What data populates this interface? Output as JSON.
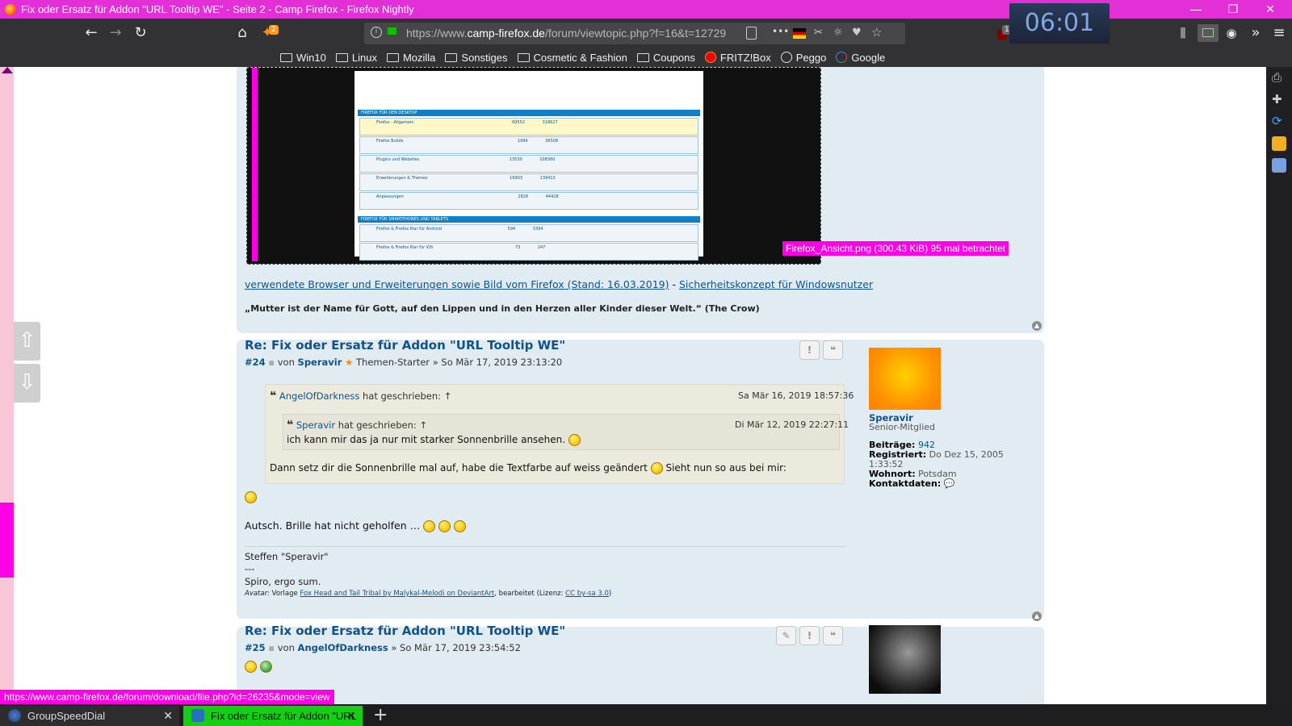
{
  "window": {
    "title": "Fix oder Ersatz für Addon \"URL Tooltip WE\" - Seite 2 - Camp Firefox - Firefox Nightly",
    "minimize": "—",
    "restore": "❐",
    "close": "✕",
    "clock": "06:01"
  },
  "toolbar": {
    "back": "←",
    "forward": "→",
    "reload": "↻",
    "home": "⌂",
    "addon_badge": "2",
    "url_prefix": "https://www.",
    "url_domain": "camp-firefox.de",
    "url_path": "/forum/viewtopic.php?f=16&t=12729",
    "more": "•••",
    "ublock_badge": "1",
    "overflow": "»",
    "menu": "≡"
  },
  "bookmarks": [
    {
      "label": "Win10",
      "icon": "folder-icon"
    },
    {
      "label": "Linux",
      "icon": "folder-icon"
    },
    {
      "label": "Mozilla",
      "icon": "folder-icon"
    },
    {
      "label": "Sonstiges",
      "icon": "folder-icon"
    },
    {
      "label": "Cosmetic & Fashion",
      "icon": "folder-icon"
    },
    {
      "label": "Coupons",
      "icon": "folder-icon"
    },
    {
      "label": "FRITZ!Box",
      "icon": "fritzbox-icon"
    },
    {
      "label": "Peggo",
      "icon": "globe-icon"
    },
    {
      "label": "Google",
      "icon": "google-icon"
    }
  ],
  "attachment": {
    "caption": "Firefox_Ansicht.png (300.43 KiB) 95 mal betrachtet",
    "forum_rows": [
      {
        "title": "Firefox - Allgemein",
        "themen": "69552",
        "beitraege": "318627"
      },
      {
        "title": "Firefox Builds",
        "themen": "1999",
        "beitraege": "36508"
      },
      {
        "title": "Plugins und Websites",
        "themen": "13530",
        "beitraege": "108360"
      },
      {
        "title": "Erweiterungen & Themes",
        "themen": "16903",
        "beitraege": "139413"
      },
      {
        "title": "Anpassungen",
        "themen": "2828",
        "beitraege": "44428"
      },
      {
        "title": "Firefox & Firefox Klar für Android",
        "themen": "594",
        "beitraege": "3394"
      },
      {
        "title": "Firefox & Firefox Klar für iOS",
        "themen": "73",
        "beitraege": "247"
      }
    ]
  },
  "prev_signature": {
    "link1": "verwendete Browser und Erweiterungen sowie Bild vom Firefox (Stand: 16.03.2019)",
    "separator": " - ",
    "link2": "Sicherheitskonzept für Windowsnutzer",
    "quote": "„Mutter ist der Name für Gott, auf den Lippen und in den Herzen aller Kinder dieser Welt.“ (The Crow)"
  },
  "post24": {
    "title": "Re: Fix oder Ersatz für Addon \"URL Tooltip WE\"",
    "number": "#24",
    "by": "von",
    "author": "Speravir",
    "role": "Themen-Starter",
    "date": "» So Mär 17, 2019 23:13:20",
    "report_btn": "!",
    "quote_btn": "❝",
    "outer_quote": {
      "author": "AngelOfDarkness",
      "wrote": "hat geschrieben: ↑",
      "date": "Sa Mär 16, 2019 18:57:36",
      "text": "Dann setz dir die Sonnenbrille mal auf, habe die Textfarbe auf weiss geändert",
      "text_after": "Sieht nun so aus bei mir:"
    },
    "inner_quote": {
      "author": "Speravir",
      "wrote": "hat geschrieben: ↑",
      "date": "Di Mär 12, 2019 22:27:11",
      "text": "ich kann mir das ja nur mit starker Sonnenbrille ansehen."
    },
    "body": "Autsch. Brille hat nicht geholfen …",
    "sig_line1": "Steffen \"Speravir\"",
    "sig_line2": "---",
    "sig_line3": "Spiro, ergo sum.",
    "sig_avatar_prefix": "Avatar:",
    "sig_avatar_text": " Vorlage ",
    "sig_avatar_link": "Fox Head and Tail Tribal by Malykal-Melodi on DeviantArt",
    "sig_avatar_mid": ", bearbeitet (Lizenz: ",
    "sig_avatar_license": "CC by-sa 3.0",
    "sig_avatar_end": ")"
  },
  "profile24": {
    "name": "Speravir",
    "rank": "Senior-Mitglied",
    "posts_label": "Beiträge:",
    "posts": "942",
    "registered_label": "Registriert:",
    "registered": "Do Dez 15, 2005",
    "registered_time": "1:33:52",
    "location_label": "Wohnort:",
    "location": "Potsdam",
    "contact_label": "Kontaktdaten:"
  },
  "post25": {
    "title": "Re: Fix oder Ersatz für Addon \"URL Tooltip WE\"",
    "number": "#25",
    "by": "von",
    "author": "AngelOfDarkness",
    "date": "» So Mär 17, 2019 23:54:52",
    "edit_btn": "✎",
    "report_btn": "!",
    "quote_btn": "❝"
  },
  "status_url": "https://www.camp-firefox.de/forum/download/file.php?id=26235&mode=view",
  "tabs": [
    {
      "label": "GroupSpeedDial",
      "close": "✕"
    },
    {
      "label": "Fix oder Ersatz für Addon \"URL",
      "close": "✕"
    }
  ],
  "new_tab": "+",
  "colors": {
    "accent": "#e22fd6",
    "highlight": "#ff00e6",
    "link": "#105289",
    "post_bg": "#e1ebf2"
  }
}
